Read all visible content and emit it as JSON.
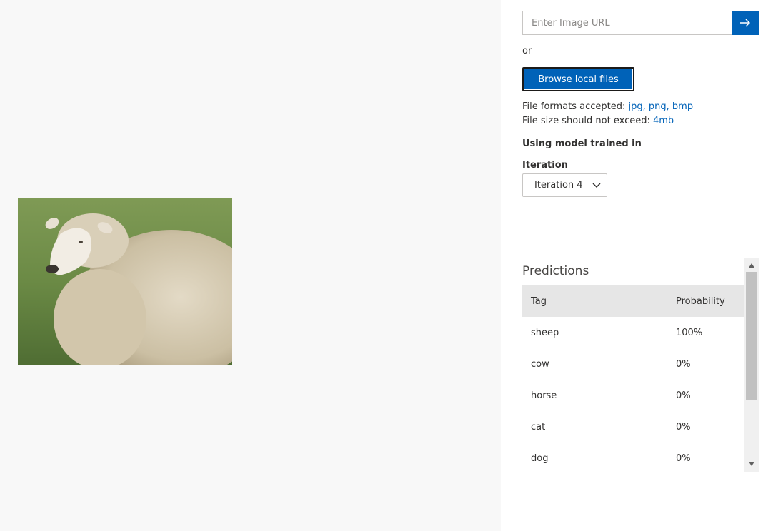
{
  "image": {
    "subject": "sheep-photo"
  },
  "url_input": {
    "placeholder": "Enter Image URL",
    "value": ""
  },
  "or_text": "or",
  "browse_button": "Browse local files",
  "file_formats": {
    "label": "File formats accepted:",
    "value": "jpg, png, bmp"
  },
  "file_size": {
    "label": "File size should not exceed:",
    "value": "4mb"
  },
  "model_label": "Using model trained in",
  "iteration": {
    "label": "Iteration",
    "selected": "Iteration 4"
  },
  "predictions": {
    "title": "Predictions",
    "columns": [
      "Tag",
      "Probability"
    ],
    "rows": [
      {
        "tag": "sheep",
        "probability": "100%"
      },
      {
        "tag": "cow",
        "probability": "0%"
      },
      {
        "tag": "horse",
        "probability": "0%"
      },
      {
        "tag": "cat",
        "probability": "0%"
      },
      {
        "tag": "dog",
        "probability": "0%"
      }
    ]
  },
  "colors": {
    "accent": "#0062b8",
    "header_bg": "#e6e6e6"
  }
}
